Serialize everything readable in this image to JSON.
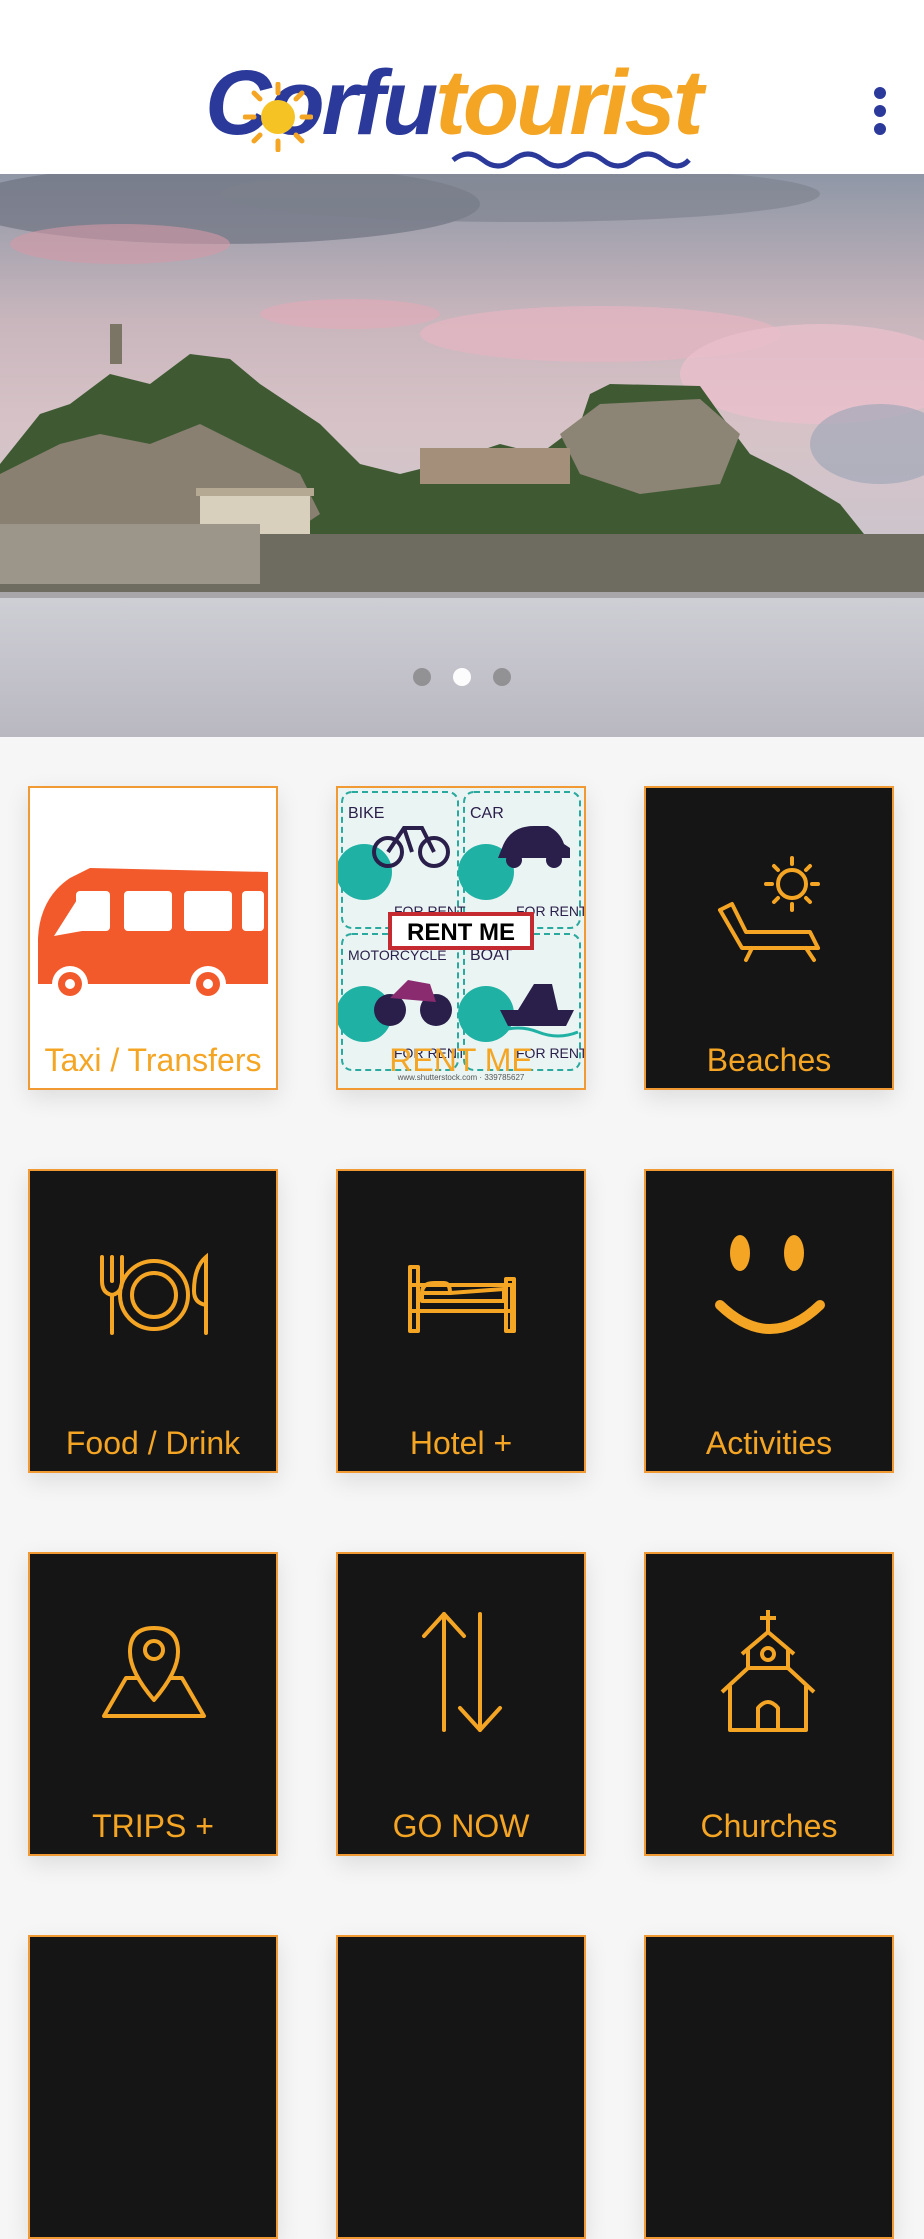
{
  "header": {
    "logo_text_part1": "Corfu",
    "logo_text_part2": "tourist",
    "menu_icon": "kebab-menu-icon"
  },
  "hero": {
    "slides_count": 3,
    "active_slide": 2
  },
  "tiles": [
    {
      "label": "Taxi / Transfers",
      "icon": "van-icon"
    },
    {
      "label": "RENT ME",
      "icon": "rent-me-image",
      "image_text": {
        "bike": "BIKE",
        "car": "CAR",
        "motorcycle": "MOTORCYCLE",
        "boat": "BOAT",
        "for_rent": "FOR RENT",
        "badge": "RENT ME",
        "credit": "www.shutterstock.com · 339785627"
      }
    },
    {
      "label": "Beaches",
      "icon": "sun-lounger-icon"
    },
    {
      "label": "Food / Drink",
      "icon": "plate-cutlery-icon"
    },
    {
      "label": "Hotel +",
      "icon": "bed-icon"
    },
    {
      "label": "Activities",
      "icon": "smiley-icon"
    },
    {
      "label": "TRIPS +",
      "icon": "map-pin-icon"
    },
    {
      "label": "GO NOW",
      "icon": "up-down-arrows-icon"
    },
    {
      "label": "Churches",
      "icon": "church-icon"
    }
  ],
  "colors": {
    "accent": "#f5a524",
    "brand_blue": "#2b3a9a",
    "tile_bg": "#151515"
  }
}
